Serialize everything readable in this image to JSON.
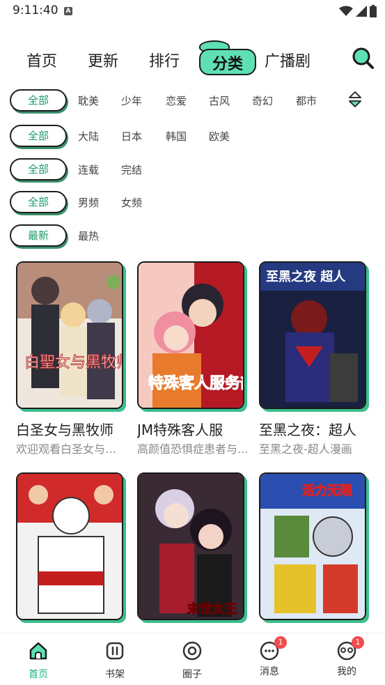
{
  "status_bar": {
    "time": "9:11:40",
    "notif_letter": "A"
  },
  "top_nav": {
    "tabs": [
      {
        "label": "首页"
      },
      {
        "label": "更新"
      },
      {
        "label": "排行"
      },
      {
        "label": "分类",
        "active": true
      },
      {
        "label": "广播剧"
      }
    ],
    "search_icon": "search-icon"
  },
  "filters": {
    "genre": {
      "selected": "全部",
      "options": [
        "耽美",
        "少年",
        "恋爱",
        "古风",
        "奇幻",
        "都市"
      ]
    },
    "region": {
      "selected": "全部",
      "options": [
        "大陆",
        "日本",
        "韩国",
        "欧美"
      ]
    },
    "status": {
      "selected": "全部",
      "options": [
        "连载",
        "完结"
      ]
    },
    "audience": {
      "selected": "全部",
      "options": [
        "男频",
        "女频"
      ]
    },
    "sort": {
      "selected": "最新",
      "options": [
        "最热"
      ]
    }
  },
  "comics": [
    {
      "title": "白圣女与黑牧师",
      "desc": "欢迎观看白圣女与黑牧师",
      "cover_text": "白聖女与黑牧师",
      "accent": "#c94b5d"
    },
    {
      "title": "JM特殊客人服",
      "desc": "高颜值恐惧症患者与...",
      "cover_text": "特殊客人服务部",
      "accent": "#c0182a"
    },
    {
      "title": "至黑之夜：超人",
      "desc": "至黑之夜-超人漫画",
      "cover_text": "至黑之夜 超人",
      "accent": "#1c2f6e"
    },
    {
      "title": "",
      "desc": "",
      "cover_text": "",
      "accent": "#d22b2b"
    },
    {
      "title": "",
      "desc": "",
      "cover_text": "末世女王",
      "accent": "#3c2b35"
    },
    {
      "title": "",
      "desc": "",
      "cover_text": "活力无限",
      "accent": "#e44a2e"
    }
  ],
  "bottom_tabs": [
    {
      "label": "首页",
      "icon": "home-icon",
      "active": true
    },
    {
      "label": "书架",
      "icon": "bookshelf-icon"
    },
    {
      "label": "圈子",
      "icon": "circle-icon"
    },
    {
      "label": "消息",
      "icon": "message-icon",
      "badge": "1"
    },
    {
      "label": "我的",
      "icon": "profile-icon",
      "badge": "1"
    }
  ],
  "colors": {
    "accent": "#5fe0b3",
    "active_text": "#19b47e",
    "badge": "#f24b4b"
  }
}
